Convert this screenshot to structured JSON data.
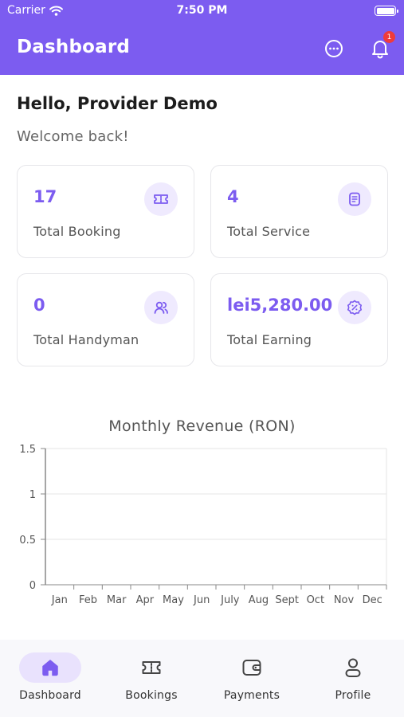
{
  "status_bar": {
    "carrier": "Carrier",
    "time": "7:50 PM"
  },
  "app_bar": {
    "title": "Dashboard",
    "notification_count": "1"
  },
  "greeting": {
    "title": "Hello, Provider Demo",
    "subtitle": "Welcome back!"
  },
  "stats": [
    {
      "value": "17",
      "label": "Total Booking",
      "icon": "ticket-icon"
    },
    {
      "value": "4",
      "label": "Total Service",
      "icon": "document-icon"
    },
    {
      "value": "0",
      "label": "Total Handyman",
      "icon": "users-icon"
    },
    {
      "value": "lei5,280.00",
      "label": "Total Earning",
      "icon": "badge-discount-icon"
    }
  ],
  "chart_data": {
    "type": "line",
    "title": "Monthly Revenue (RON)",
    "xlabel": "",
    "ylabel": "",
    "categories": [
      "Jan",
      "Feb",
      "Mar",
      "Apr",
      "May",
      "Jun",
      "July",
      "Aug",
      "Sept",
      "Oct",
      "Nov",
      "Dec"
    ],
    "series": [],
    "ylim": [
      0,
      1.5
    ],
    "yticks": [
      "0",
      "0.5",
      "1",
      "1.5"
    ],
    "grid": true,
    "colors": {
      "axis": "#888888",
      "grid": "#e6e6e6",
      "text": "#555555"
    }
  },
  "bottom_nav": {
    "items": [
      {
        "label": "Dashboard",
        "icon": "home-icon",
        "active": true
      },
      {
        "label": "Bookings",
        "icon": "ticket-icon",
        "active": false
      },
      {
        "label": "Payments",
        "icon": "wallet-icon",
        "active": false
      },
      {
        "label": "Profile",
        "icon": "user-icon",
        "active": false
      }
    ]
  },
  "colors": {
    "primary": "#7c5cf0",
    "primary_light": "#efeafe",
    "badge": "#ef3b3b"
  }
}
